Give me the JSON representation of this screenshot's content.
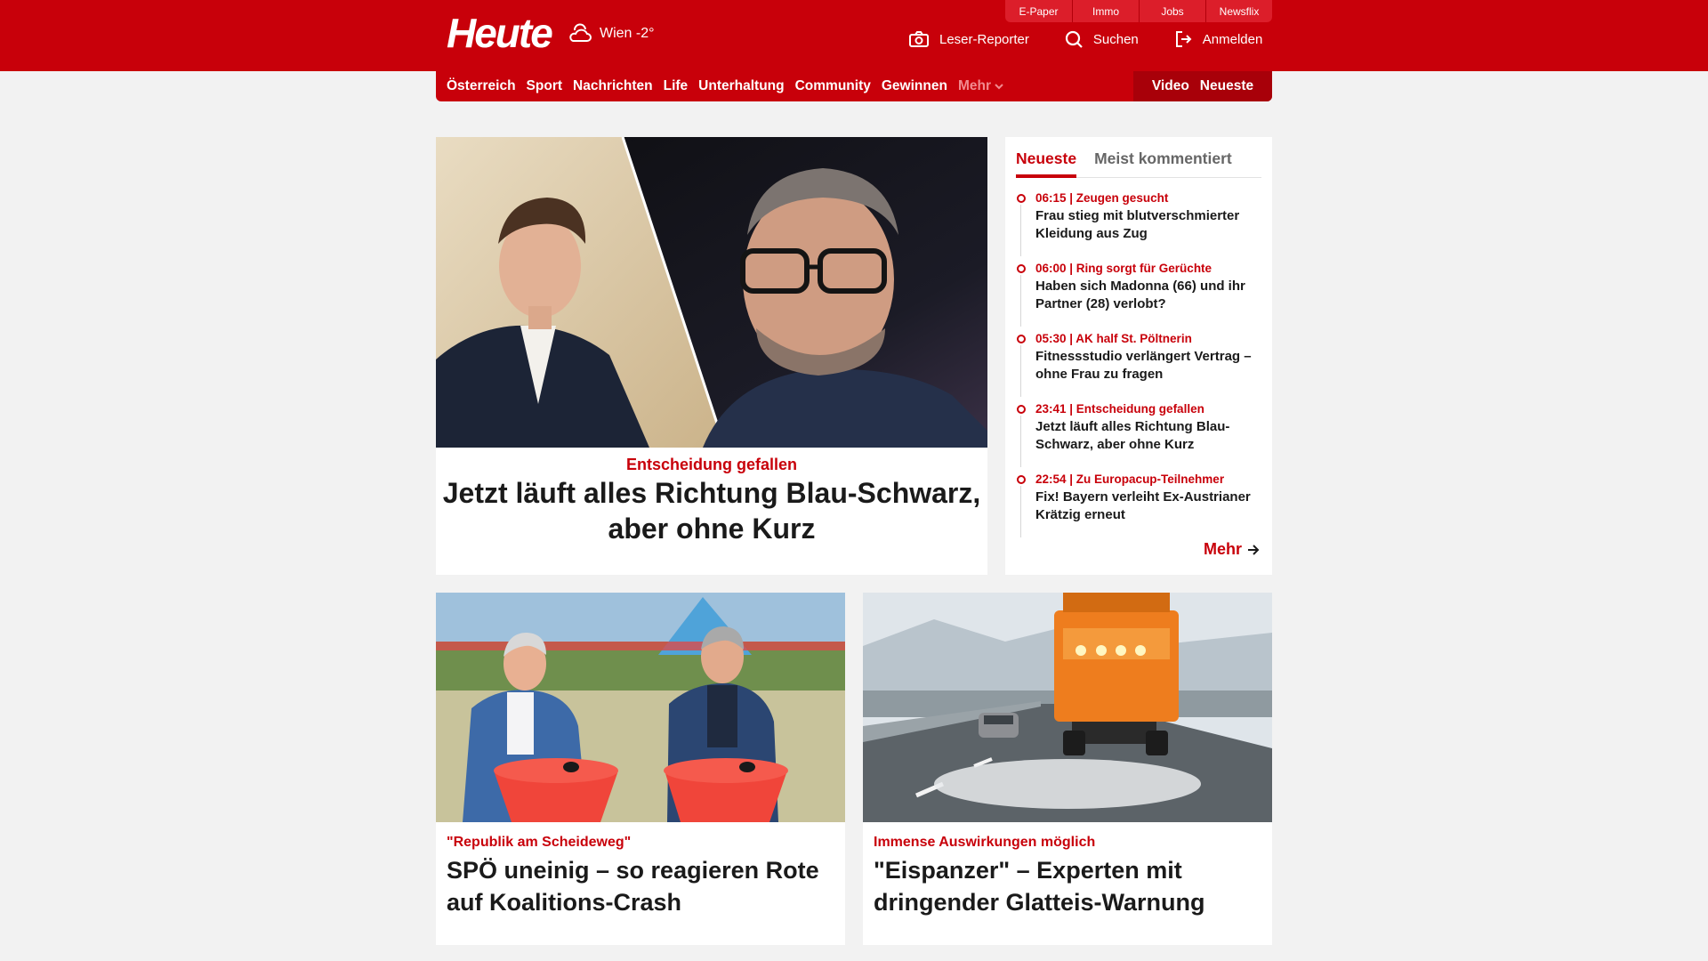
{
  "header": {
    "logo": "Heute",
    "weather": "Wien -2°",
    "service_tabs": [
      "E-Paper",
      "Immo",
      "Jobs",
      "Newsflix"
    ],
    "actions": [
      {
        "label": "Leser-Reporter",
        "icon": "camera-icon"
      },
      {
        "label": "Suchen",
        "icon": "search-icon"
      },
      {
        "label": "Anmelden",
        "icon": "login-icon"
      }
    ]
  },
  "nav": {
    "items": [
      "Österreich",
      "Sport",
      "Nachrichten",
      "Life",
      "Unterhaltung",
      "Community",
      "Gewinnen"
    ],
    "more": "Mehr",
    "right": [
      "Video",
      "Neueste"
    ]
  },
  "hero": {
    "kicker": "Entscheidung gefallen",
    "title": "Jetzt läuft alles Richtung Blau-Schwarz, aber ohne Kurz"
  },
  "latest": {
    "tabs": [
      "Neueste",
      "Meist kommentiert"
    ],
    "items": [
      {
        "meta": "06:15 | Zeugen gesucht",
        "headline": "Frau stieg mit blutverschmierter Kleidung aus Zug"
      },
      {
        "meta": "06:00 | Ring sorgt für Gerüchte",
        "headline": "Haben sich Madonna (66) und ihr Partner (28) verlobt?"
      },
      {
        "meta": "05:30 | AK half St. Pöltnerin",
        "headline": "Fitnessstudio verlängert Vertrag – ohne Frau zu fragen"
      },
      {
        "meta": "23:41 | Entscheidung gefallen",
        "headline": "Jetzt läuft alles Richtung Blau-Schwarz, aber ohne Kurz"
      },
      {
        "meta": "22:54 | Zu Europacup-Teilnehmer",
        "headline": "Fix! Bayern verleiht Ex-Austrianer Krätzig erneut"
      }
    ],
    "more": "Mehr"
  },
  "teasers": [
    {
      "kicker": "\"Republik am Scheideweg\"",
      "title": "SPÖ uneinig – so reagieren Rote auf Koalitions-Crash"
    },
    {
      "kicker": "Immense Auswirkungen möglich",
      "title": "\"Eispanzer\" – Experten mit dringender Glatteis-Warnung"
    }
  ],
  "colors": {
    "brand": "#c8000a",
    "background": "#f2f2f2"
  }
}
